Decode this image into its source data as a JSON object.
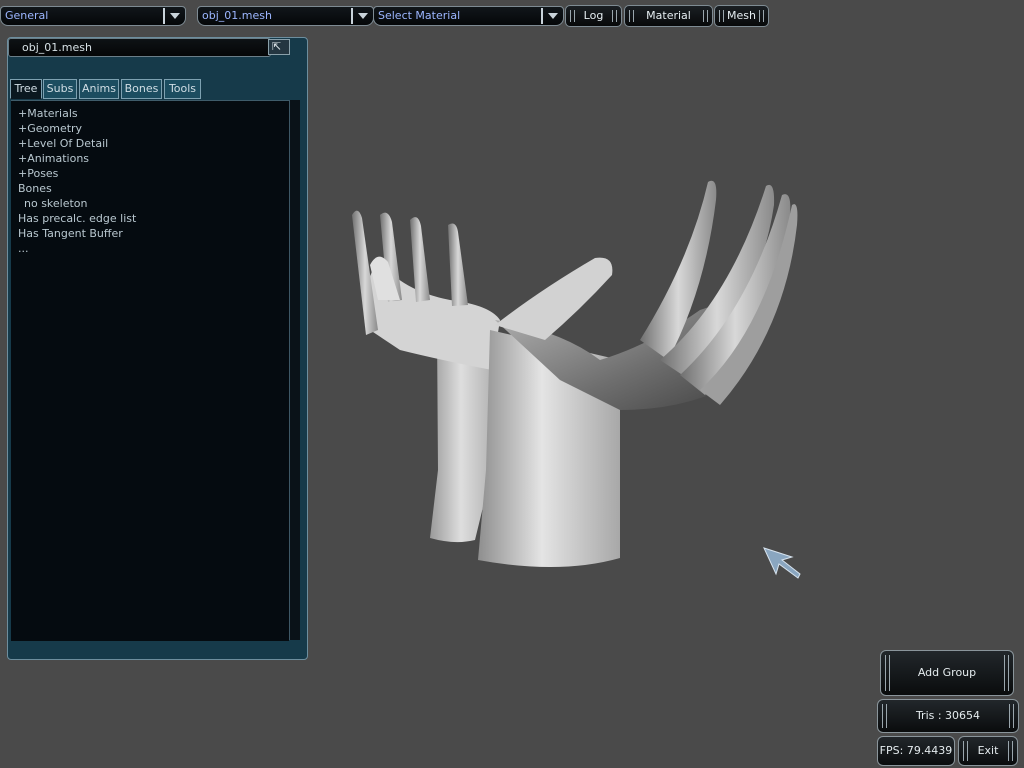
{
  "toolbar": {
    "general_combo": "General",
    "mesh_combo": "obj_01.mesh",
    "material_combo": "Select Material",
    "log_button": "Log",
    "material_button": "Material",
    "mesh_button": "Mesh"
  },
  "panel": {
    "title": "obj_01.mesh",
    "tabs": [
      "Tree",
      "Subs",
      "Anims",
      "Bones",
      "Tools"
    ],
    "active_tab": "Tree",
    "tree": [
      "+Materials",
      "+Geometry",
      "+Level Of Detail",
      "+Animations",
      "+Poses",
      "Bones",
      "no skeleton",
      "Has precalc. edge list",
      "Has Tangent Buffer",
      "..."
    ]
  },
  "status": {
    "add_group": "Add Group",
    "tris": "Tris : 30654",
    "fps": "FPS: 79.4439",
    "exit": "Exit"
  },
  "colors": {
    "viewport_bg": "#4a4a4a",
    "panel_frame": "#163a4a",
    "panel_body": "#050b10",
    "combo_text": "#9cb6ff"
  },
  "icons": {
    "combo_arrow": "chevron-down-icon",
    "panel_close": "close-icon",
    "cursor": "mouse-pointer-icon"
  }
}
